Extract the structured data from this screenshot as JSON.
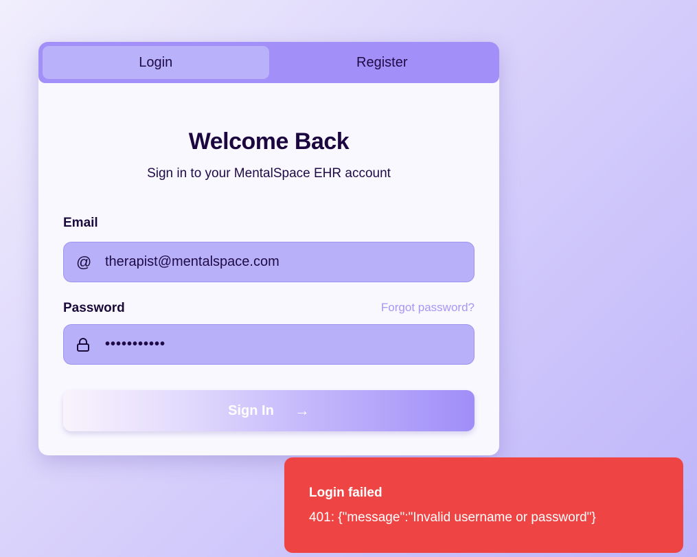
{
  "tabs": [
    {
      "label": "Login",
      "active": true
    },
    {
      "label": "Register",
      "active": false
    }
  ],
  "heading": "Welcome Back",
  "subheading": "Sign in to your MentalSpace EHR account",
  "email": {
    "label": "Email",
    "value": "therapist@mentalspace.com",
    "icon": "at-icon"
  },
  "password": {
    "label": "Password",
    "value": "•••••••••••",
    "icon": "lock-icon",
    "forgot": "Forgot password?"
  },
  "submit": {
    "label": "Sign In",
    "icon": "arrow-right-icon"
  },
  "toast": {
    "title": "Login failed",
    "message": "401: {\"message\":\"Invalid username or password\"}",
    "color": "#ef4444"
  }
}
